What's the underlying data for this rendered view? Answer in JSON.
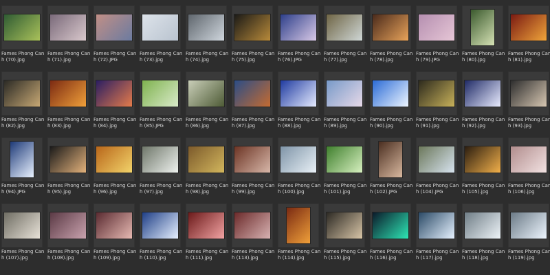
{
  "window": {
    "title": ""
  },
  "files": [
    {
      "name": "Fames Phong Canh (70).jpg",
      "orientation": "landscape",
      "colors": [
        "#2f5b33",
        "#a9c15a"
      ]
    },
    {
      "name": "Fames Phong Canh (71).jpg",
      "orientation": "landscape",
      "colors": [
        "#7a6a7a",
        "#d9c8cc"
      ]
    },
    {
      "name": "Fames Phong Canh (72).JPG",
      "orientation": "landscape",
      "colors": [
        "#c18f86",
        "#6b7ba0"
      ]
    },
    {
      "name": "Fames Phong Canh (73).jpg",
      "orientation": "landscape",
      "colors": [
        "#dde3ea",
        "#b9c3cf"
      ]
    },
    {
      "name": "Fames Phong Canh (74).jpg",
      "orientation": "landscape",
      "colors": [
        "#5f666d",
        "#cfd6dd"
      ]
    },
    {
      "name": "Fames Phong Canh (75).jpg",
      "orientation": "landscape",
      "colors": [
        "#1b1a17",
        "#b88a3a"
      ]
    },
    {
      "name": "Fames Phong Canh (76).JPG",
      "orientation": "landscape",
      "colors": [
        "#2d3f8a",
        "#d9c9e6"
      ]
    },
    {
      "name": "Fames Phong Canh (77).jpg",
      "orientation": "landscape",
      "colors": [
        "#6f6545",
        "#cfd7d6"
      ]
    },
    {
      "name": "Fames Phong Canh (78).jpg",
      "orientation": "landscape",
      "colors": [
        "#4a2a1b",
        "#e8a35a"
      ]
    },
    {
      "name": "Fames Phong Canh (79).JPG",
      "orientation": "landscape",
      "colors": [
        "#b58fb0",
        "#e6c6d6"
      ]
    },
    {
      "name": "Fames Phong Canh (80).jpg",
      "orientation": "portrait",
      "colors": [
        "#3b5a2e",
        "#d6e2b5"
      ]
    },
    {
      "name": "Fames Phong Canh (81).jpg",
      "orientation": "landscape",
      "colors": [
        "#7a1a12",
        "#f0a53a"
      ]
    },
    {
      "name": "Fames Phong Canh (82).jpg",
      "orientation": "landscape",
      "colors": [
        "#2b2a25",
        "#c7a874"
      ]
    },
    {
      "name": "Fames Phong Canh (83).jpg",
      "orientation": "landscape",
      "colors": [
        "#7b2a12",
        "#f0a03a"
      ]
    },
    {
      "name": "Fames Phong Canh (84).jpg",
      "orientation": "landscape",
      "colors": [
        "#2b1e62",
        "#e47b4b"
      ]
    },
    {
      "name": "Fames Phong Canh (85).JPG",
      "orientation": "landscape",
      "colors": [
        "#7fb24f",
        "#d9eac9"
      ]
    },
    {
      "name": "Fames Phong Canh (86).jpg",
      "orientation": "landscape",
      "colors": [
        "#c9ceb8",
        "#4e5b36"
      ]
    },
    {
      "name": "Fames Phong Canh (87).jpg",
      "orientation": "landscape",
      "colors": [
        "#2b4d86",
        "#c46b31"
      ]
    },
    {
      "name": "Fames Phong Canh (88).jpg",
      "orientation": "landscape",
      "colors": [
        "#1f3aa0",
        "#e6ecff"
      ]
    },
    {
      "name": "Fames Phong Canh (89).jpg",
      "orientation": "landscape",
      "colors": [
        "#7799c8",
        "#e7d9e8"
      ]
    },
    {
      "name": "Fames Phong Canh (90).jpg",
      "orientation": "landscape",
      "colors": [
        "#2b6bd6",
        "#eef6ff"
      ]
    },
    {
      "name": "Fames Phong Canh (91).jpg",
      "orientation": "landscape",
      "colors": [
        "#2d2a1d",
        "#c7b15a"
      ]
    },
    {
      "name": "Fames Phong Canh (92).jpg",
      "orientation": "landscape",
      "colors": [
        "#1f2a66",
        "#e9ecff"
      ]
    },
    {
      "name": "Fames Phong Canh (93).jpg",
      "orientation": "landscape",
      "colors": [
        "#2d2d2d",
        "#d7c7b2"
      ]
    },
    {
      "name": "Fames Phong Canh (94).JPG",
      "orientation": "portrait",
      "colors": [
        "#1e3a78",
        "#e9f2ff"
      ]
    },
    {
      "name": "Fames Phong Canh (95).jpg",
      "orientation": "landscape",
      "colors": [
        "#1a1a1a",
        "#e3b27b"
      ]
    },
    {
      "name": "Fames Phong Canh (96).jpg",
      "orientation": "landscape",
      "colors": [
        "#b8661a",
        "#f2d36a"
      ]
    },
    {
      "name": "Fames Phong Canh (97).jpg",
      "orientation": "landscape",
      "colors": [
        "#6f776a",
        "#eef1ee"
      ]
    },
    {
      "name": "Fames Phong Canh (98).jpg",
      "orientation": "landscape",
      "colors": [
        "#7c5a2b",
        "#d2b65d"
      ]
    },
    {
      "name": "Fames Phong Canh (99).jpg",
      "orientation": "landscape",
      "colors": [
        "#6c3424",
        "#d7b7a9"
      ]
    },
    {
      "name": "Fames Phong Canh (100).jpg",
      "orientation": "landscape",
      "colors": [
        "#7f95a8",
        "#e9f0f6"
      ]
    },
    {
      "name": "Fames Phong Canh (101).jpg",
      "orientation": "landscape",
      "colors": [
        "#3f7f2d",
        "#d7f0c0"
      ]
    },
    {
      "name": "Fames Phong Canh (102).JPG",
      "orientation": "portrait",
      "colors": [
        "#4a2e20",
        "#d9b9a0"
      ]
    },
    {
      "name": "Fames Phong Canh (104).JPG",
      "orientation": "landscape",
      "colors": [
        "#6b775a",
        "#d7e3ef"
      ]
    },
    {
      "name": "Fames Phong Canh (105).jpg",
      "orientation": "landscape",
      "colors": [
        "#2a1d10",
        "#f2b04a"
      ]
    },
    {
      "name": "Fames Phong Canh (106).jpg",
      "orientation": "landscape",
      "colors": [
        "#b18d8d",
        "#f2e2e2"
      ]
    },
    {
      "name": "Fames Phong Canh (107).jpg",
      "orientation": "landscape",
      "colors": [
        "#6f6d63",
        "#e8e2d8"
      ]
    },
    {
      "name": "Fames Phong Canh (108).jpg",
      "orientation": "landscape",
      "colors": [
        "#5b3a45",
        "#c9a2ae"
      ]
    },
    {
      "name": "Fames Phong Canh (109).jpg",
      "orientation": "landscape",
      "colors": [
        "#5a2b31",
        "#e6b9b2"
      ]
    },
    {
      "name": "Fames Phong Canh (110).jpg",
      "orientation": "landscape",
      "colors": [
        "#1f3f86",
        "#e6f0ff"
      ]
    },
    {
      "name": "Fames Phong Canh (111).jpg",
      "orientation": "landscape",
      "colors": [
        "#6b1a1a",
        "#f2a3a3"
      ]
    },
    {
      "name": "Fames Phong Canh (113).jpg",
      "orientation": "landscape",
      "colors": [
        "#6b2a2a",
        "#d7b2b2"
      ]
    },
    {
      "name": "Fames Phong Canh (114).jpg",
      "orientation": "portrait",
      "colors": [
        "#7a2a12",
        "#f0a03a"
      ]
    },
    {
      "name": "Fames Phong Canh (115).jpg",
      "orientation": "landscape",
      "colors": [
        "#2d2a24",
        "#d8c5a7"
      ]
    },
    {
      "name": "Fames Phong Canh (116).jpg",
      "orientation": "landscape",
      "colors": [
        "#0b1a2a",
        "#2ee6b5"
      ]
    },
    {
      "name": "Fames Phong Canh (117).jpg",
      "orientation": "landscape",
      "colors": [
        "#2b4a66",
        "#e6f2ff"
      ]
    },
    {
      "name": "Fames Phong Canh (118).jpg",
      "orientation": "landscape",
      "colors": [
        "#6f7d86",
        "#eef4f8"
      ]
    },
    {
      "name": "Fames Phong Canh (119).jpg",
      "orientation": "landscape",
      "colors": [
        "#6b7a86",
        "#eef6ff"
      ]
    }
  ]
}
